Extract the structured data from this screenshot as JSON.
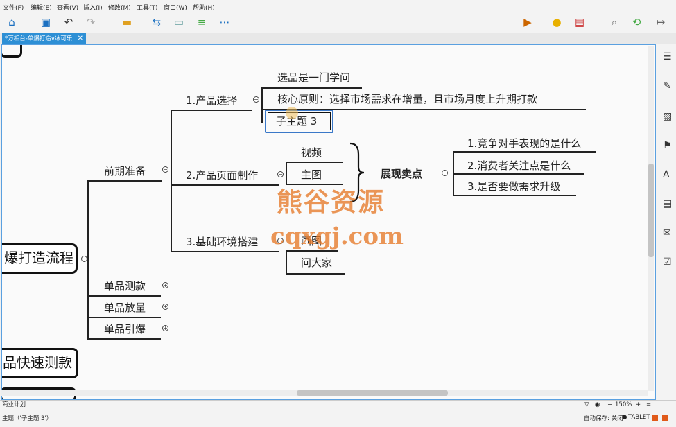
{
  "menu": [
    "文件(F)",
    "编辑(E)",
    "查看(V)",
    "插入(I)",
    "修改(M)",
    "工具(T)",
    "窗口(W)",
    "帮助(H)"
  ],
  "tab": {
    "label": "*万相台-单爆打造v冰可乐",
    "close": "✕"
  },
  "mindmap": {
    "central": "爆打造流程",
    "bottom_topic": "品快速测款",
    "branch_main": "前期准备",
    "branches_other": [
      "单品测款",
      "单品放量",
      "单品引爆"
    ],
    "sub1": "1.产品选择",
    "sub1_items": [
      "选品是一门学问",
      "核心原则：选择市场需求在增量，且市场月度上升期打款",
      "子主题 3"
    ],
    "sub2": "2.产品页面制作",
    "sub2_items": [
      "视频",
      "主图"
    ],
    "sub2_summary": "展现卖点",
    "summary_items": [
      "1.竞争对手表现的是什么",
      "2.消费者关注点是什么",
      "3.是否要做需求升级"
    ],
    "sub3": "3.基础环境搭建",
    "sub3_items": [
      "画图",
      "问大家"
    ]
  },
  "watermark": {
    "line1": "熊谷资源",
    "line2": "cqxgj.com"
  },
  "sheet_tab": "商业计划",
  "zoom": {
    "minus": "−",
    "value": "150%",
    "plus": "+"
  },
  "status": {
    "selection": "主题（'子主题 3'）",
    "autosave": "自动保存: 关闭",
    "device": "TABLET"
  },
  "colors": {
    "accent": "#2d8fd5",
    "watermark": "#e67828"
  }
}
